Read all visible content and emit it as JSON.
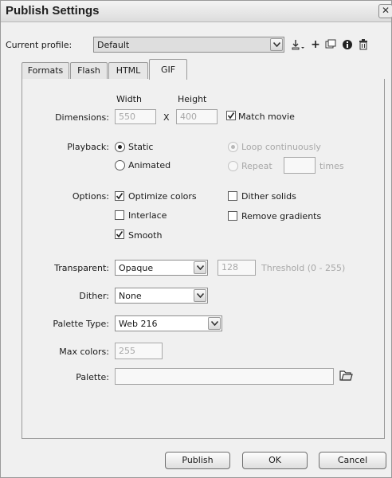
{
  "window": {
    "title": "Publish Settings",
    "close_glyph": "✕"
  },
  "profile": {
    "label": "Current profile:",
    "value": "Default",
    "tools": [
      "import-export-icon",
      "add-icon",
      "duplicate-icon",
      "info-icon",
      "delete-icon"
    ]
  },
  "tabs": [
    "Formats",
    "Flash",
    "HTML",
    "GIF"
  ],
  "active_tab": "GIF",
  "dimensions": {
    "label": "Dimensions:",
    "width_header": "Width",
    "height_header": "Height",
    "width": "550",
    "height": "400",
    "x": "X",
    "match_movie": {
      "label": "Match movie",
      "checked": true
    }
  },
  "playback": {
    "label": "Playback:",
    "static": {
      "label": "Static",
      "selected": true
    },
    "animated": {
      "label": "Animated",
      "selected": false
    },
    "loop": {
      "label": "Loop continuously",
      "selected": true,
      "enabled": false
    },
    "repeat": {
      "label": "Repeat",
      "selected": false,
      "enabled": false
    },
    "times": "times",
    "repeat_value": ""
  },
  "options": {
    "label": "Options:",
    "optimize_colors": {
      "label": "Optimize colors",
      "checked": true
    },
    "dither_solids": {
      "label": "Dither solids",
      "checked": false
    },
    "interlace": {
      "label": "Interlace",
      "checked": false
    },
    "remove_gradients": {
      "label": "Remove gradients",
      "checked": false
    },
    "smooth": {
      "label": "Smooth",
      "checked": true
    }
  },
  "transparent": {
    "label": "Transparent:",
    "value": "Opaque",
    "threshold_value": "128",
    "threshold_label": "Threshold (0 - 255)"
  },
  "dither": {
    "label": "Dither:",
    "value": "None"
  },
  "palette_type": {
    "label": "Palette Type:",
    "value": "Web 216"
  },
  "max_colors": {
    "label": "Max colors:",
    "value": "255"
  },
  "palette": {
    "label": "Palette:",
    "value": ""
  },
  "buttons": {
    "publish": "Publish",
    "ok": "OK",
    "cancel": "Cancel"
  },
  "colors": {
    "window_bg": "#f0f0f0",
    "disabled_text": "#a8a8a8",
    "border": "#9a9a9a"
  }
}
